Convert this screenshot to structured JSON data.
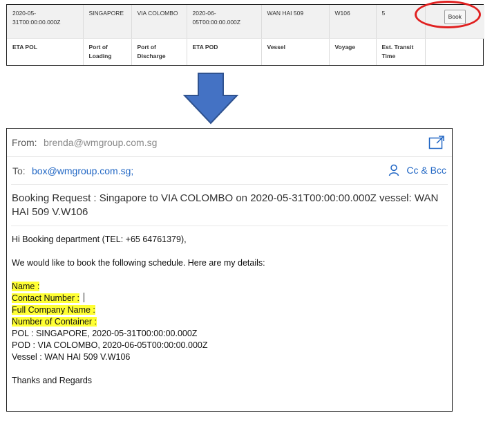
{
  "schedule": {
    "values": [
      "2020-05-31T00:00:00.000Z",
      "SINGAPORE",
      "VIA COLOMBO",
      "2020-06-05T00:00:00.000Z",
      "WAN HAI 509",
      "W106",
      "5"
    ],
    "headers": [
      "ETA POL",
      "Port of Loading",
      "Port of Discharge",
      "ETA POD",
      "Vessel",
      "Voyage",
      "Est. Transit Time"
    ],
    "book_label": "Book"
  },
  "colors": {
    "accent": "#2066c4",
    "arrow": "#4472c4",
    "highlight": "#ffff33",
    "annotation": "#e02020"
  },
  "email": {
    "from_label": "From:",
    "from_value": "brenda@wmgroup.com.sg",
    "to_label": "To:",
    "to_value": "box@wmgroup.com.sg;",
    "cc_bcc_label": "Cc & Bcc",
    "subject": "Booking Request : Singapore to VIA COLOMBO on 2020-05-31T00:00:00.000Z vessel: WAN HAI 509 V.W106",
    "greeting": "Hi Booking department  (TEL: +65 64761379),",
    "intro": "We would like to book the following schedule. Here are my details:",
    "fields": [
      "Name :",
      "Contact Number :",
      "Full Company Name :",
      "Number of Container :"
    ],
    "details": [
      "POL : SINGAPORE, 2020-05-31T00:00:00.000Z",
      "POD : VIA COLOMBO, 2020-06-05T00:00:00.000Z",
      "Vessel : WAN HAI 509 V.W106"
    ],
    "closing": "Thanks and Regards"
  },
  "icons": [
    "popout-icon",
    "person-icon",
    "down-arrow-icon"
  ]
}
